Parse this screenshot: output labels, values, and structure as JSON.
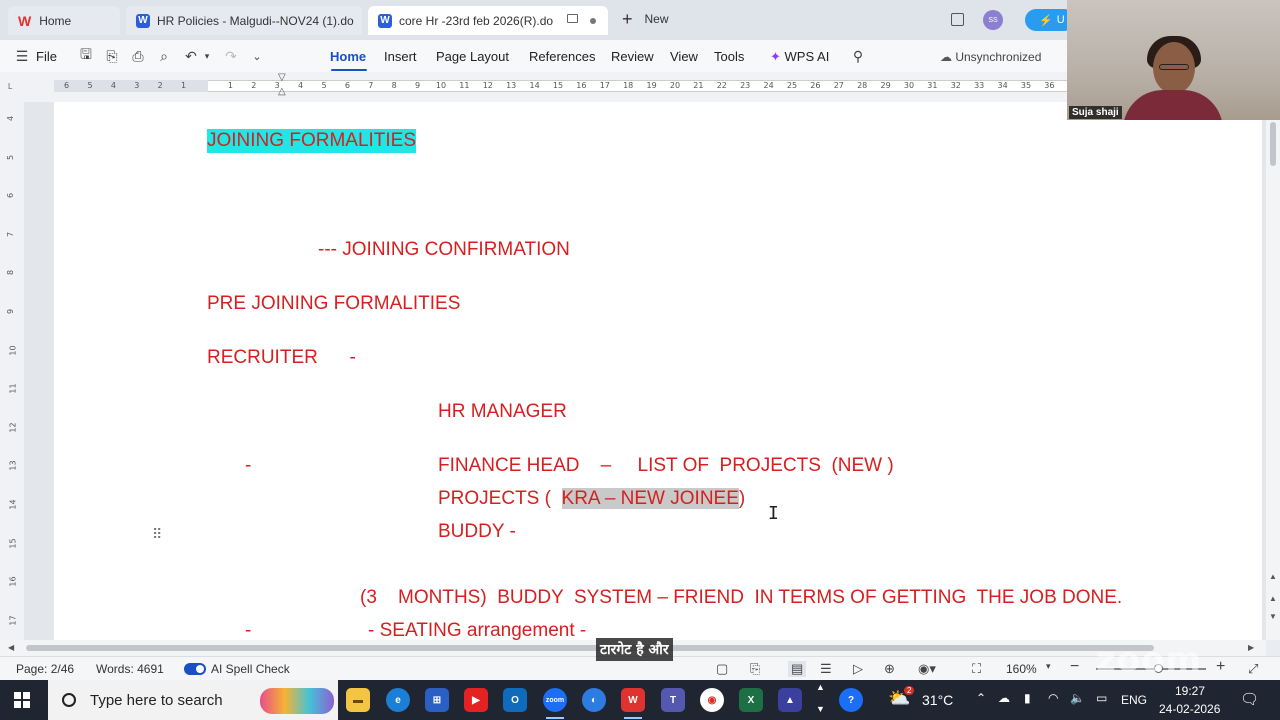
{
  "tabs": [
    {
      "label": "Home"
    },
    {
      "label": "HR Policies  - Malgudi--NOV24 (1).do"
    },
    {
      "label": "core Hr -23rd  feb 2026(R).do"
    }
  ],
  "new_tab_label": "New",
  "avatar_initials": "SS",
  "upgrade_label": "U",
  "menu": {
    "file": "File",
    "items": [
      "Home",
      "Insert",
      "Page Layout",
      "References",
      "Review",
      "View",
      "Tools"
    ],
    "wps_ai": "WPS AI",
    "sync_status": "Unsynchronized"
  },
  "ruler": {
    "left": [
      "6",
      "5",
      "4",
      "3",
      "2",
      "1"
    ],
    "right": [
      "1",
      "2",
      "3",
      "4",
      "5",
      "6",
      "7",
      "8",
      "9",
      "10",
      "11",
      "12",
      "13",
      "14",
      "15",
      "16",
      "17",
      "18",
      "19",
      "20",
      "21",
      "22",
      "23",
      "24",
      "25",
      "26",
      "27",
      "28",
      "29",
      "30",
      "31",
      "32",
      "33",
      "34",
      "35",
      "36"
    ],
    "corner": "L",
    "vertical": [
      "4",
      "5",
      "6",
      "7",
      "8",
      "9",
      "10",
      "11",
      "12",
      "13",
      "14",
      "15",
      "16",
      "17"
    ]
  },
  "document": {
    "heading": "JOINING FORMALITIES",
    "line_confirmation": "--- JOINING CONFIRMATION",
    "line_pre_joining": "PRE JOINING FORMALITIES",
    "line_recruiter": "RECRUITER      -",
    "line_hr_manager": "HR MANAGER",
    "dash_1": "-",
    "line_finance": "FINANCE HEAD    –     LIST OF  PROJECTS  (NEW )",
    "projects_prefix": "PROJECTS (  ",
    "projects_highlight": "KRA – NEW JOINEE",
    "projects_suffix": ")",
    "line_buddy": "BUDDY -",
    "line_buddy_system": "(3    MONTHS)  BUDDY  SYSTEM – FRIEND  IN TERMS OF GETTING  THE JOB DONE.",
    "dash_2": "-",
    "line_seating": "- SEATING arrangement -"
  },
  "status": {
    "page": "Page: 2/46",
    "words": "Words: 4691",
    "spell_check": "AI Spell Check",
    "zoom": "160%"
  },
  "caption": "टारगेट है और",
  "watermark": "zoom",
  "video": {
    "name": "Suja shaji"
  },
  "taskbar": {
    "search_placeholder": "Type here to search",
    "temperature": "31°C",
    "language": "ENG",
    "time": "19:27",
    "date": "24-02-2026",
    "weather_badge": "2"
  }
}
